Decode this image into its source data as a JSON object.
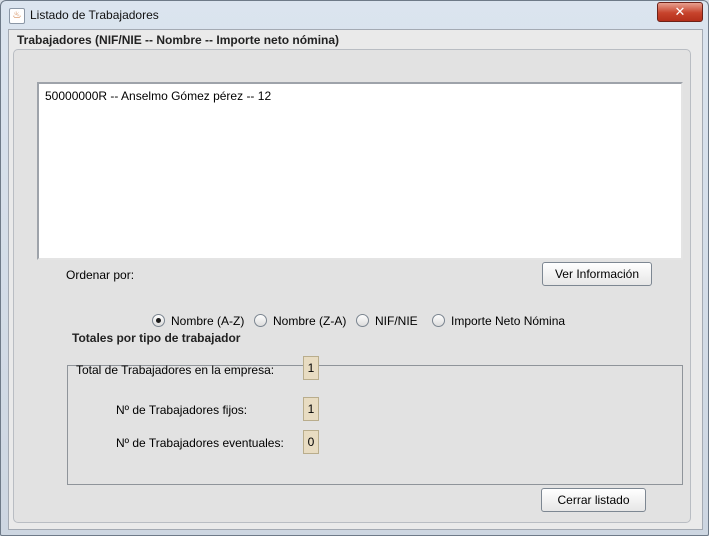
{
  "window": {
    "title": "Listado de Trabajadores",
    "close_glyph": "✕"
  },
  "list_group": {
    "title": "Trabajadores (NIF/NIE -- Nombre -- Importe neto nómina)",
    "items": [
      "50000000R -- Anselmo Gómez pérez -- 12"
    ]
  },
  "sort": {
    "label": "Ordenar por:",
    "options": [
      "Nombre (A-Z)",
      "Nombre (Z-A)",
      "NIF/NIE",
      "Importe Neto Nómina"
    ],
    "selected": "Nombre (A-Z)"
  },
  "buttons": {
    "ver_info": "Ver Información",
    "cerrar": "Cerrar listado"
  },
  "totals": {
    "title": "Totales por tipo de trabajador",
    "total_label": "Total de Trabajadores en la empresa:",
    "total_value": "1",
    "fijos_label": "Nº de Trabajadores fijos:",
    "fijos_value": "1",
    "eventuales_label": "Nº de Trabajadores eventuales:",
    "eventuales_value": "0"
  },
  "colors": {
    "close_button": "#c7432c",
    "count_field": "#e8dcc2"
  },
  "icons": {
    "app": "java-icon",
    "close": "close-icon"
  }
}
